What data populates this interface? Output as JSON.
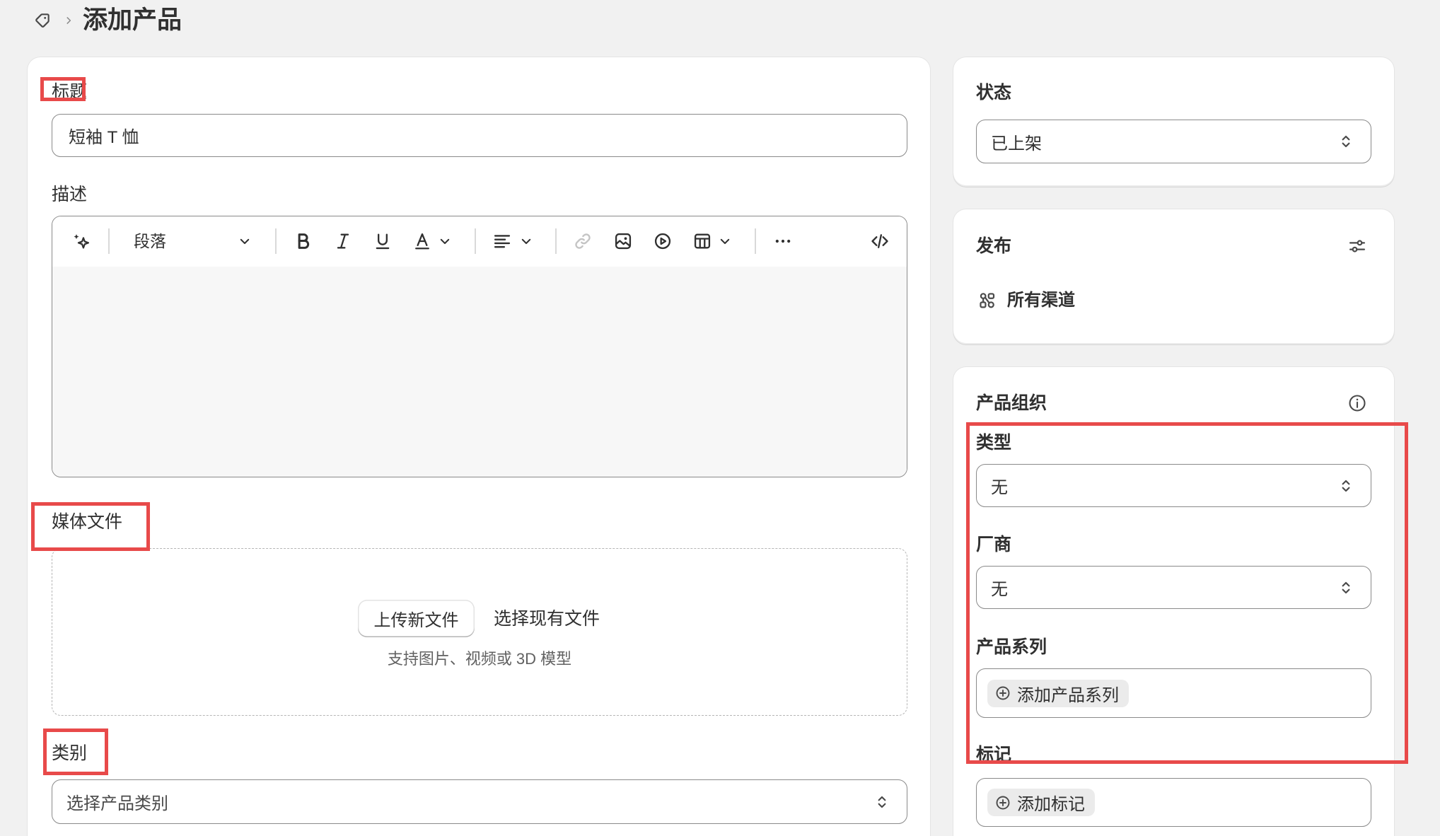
{
  "header": {
    "icon": "tag-icon",
    "separator_icon": "chevron-right-icon",
    "title": "添加产品"
  },
  "product": {
    "title_field": {
      "label": "标题",
      "value": "短袖 T 恤"
    },
    "description": {
      "label": "描述",
      "paragraph_format": "段落",
      "toolbar_icons": [
        "ai-sparkle-icon",
        "bold-icon",
        "italic-icon",
        "underline-icon",
        "text-color-icon",
        "align-left-icon",
        "link-icon",
        "image-icon",
        "play-circle-icon",
        "table-icon",
        "more-horizontal-icon",
        "code-icon"
      ]
    },
    "media": {
      "label": "媒体文件",
      "upload_label": "上传新文件",
      "select_existing_label": "选择现有文件",
      "hint": "支持图片、视频或 3D 模型"
    },
    "category": {
      "label": "类别",
      "placeholder": "选择产品类别"
    }
  },
  "status": {
    "label": "状态",
    "value": "已上架"
  },
  "publishing": {
    "label": "发布",
    "channels_label": "所有渠道",
    "settings_icon": "sliders-icon"
  },
  "organization": {
    "label": "产品组织",
    "info_icon": "info-icon",
    "type": {
      "label": "类型",
      "value": "无"
    },
    "vendor": {
      "label": "厂商",
      "value": "无"
    },
    "collections": {
      "label": "产品系列",
      "add_label": "添加产品系列"
    },
    "tags": {
      "label": "标记",
      "add_label": "添加标记"
    }
  },
  "colors": {
    "page_background": "#f1f1f1",
    "card_background": "#ffffff",
    "text_primary": "#303030",
    "text_secondary": "#616161",
    "annotation_red": "#e84a4a",
    "chip_background": "#ebebeb"
  }
}
